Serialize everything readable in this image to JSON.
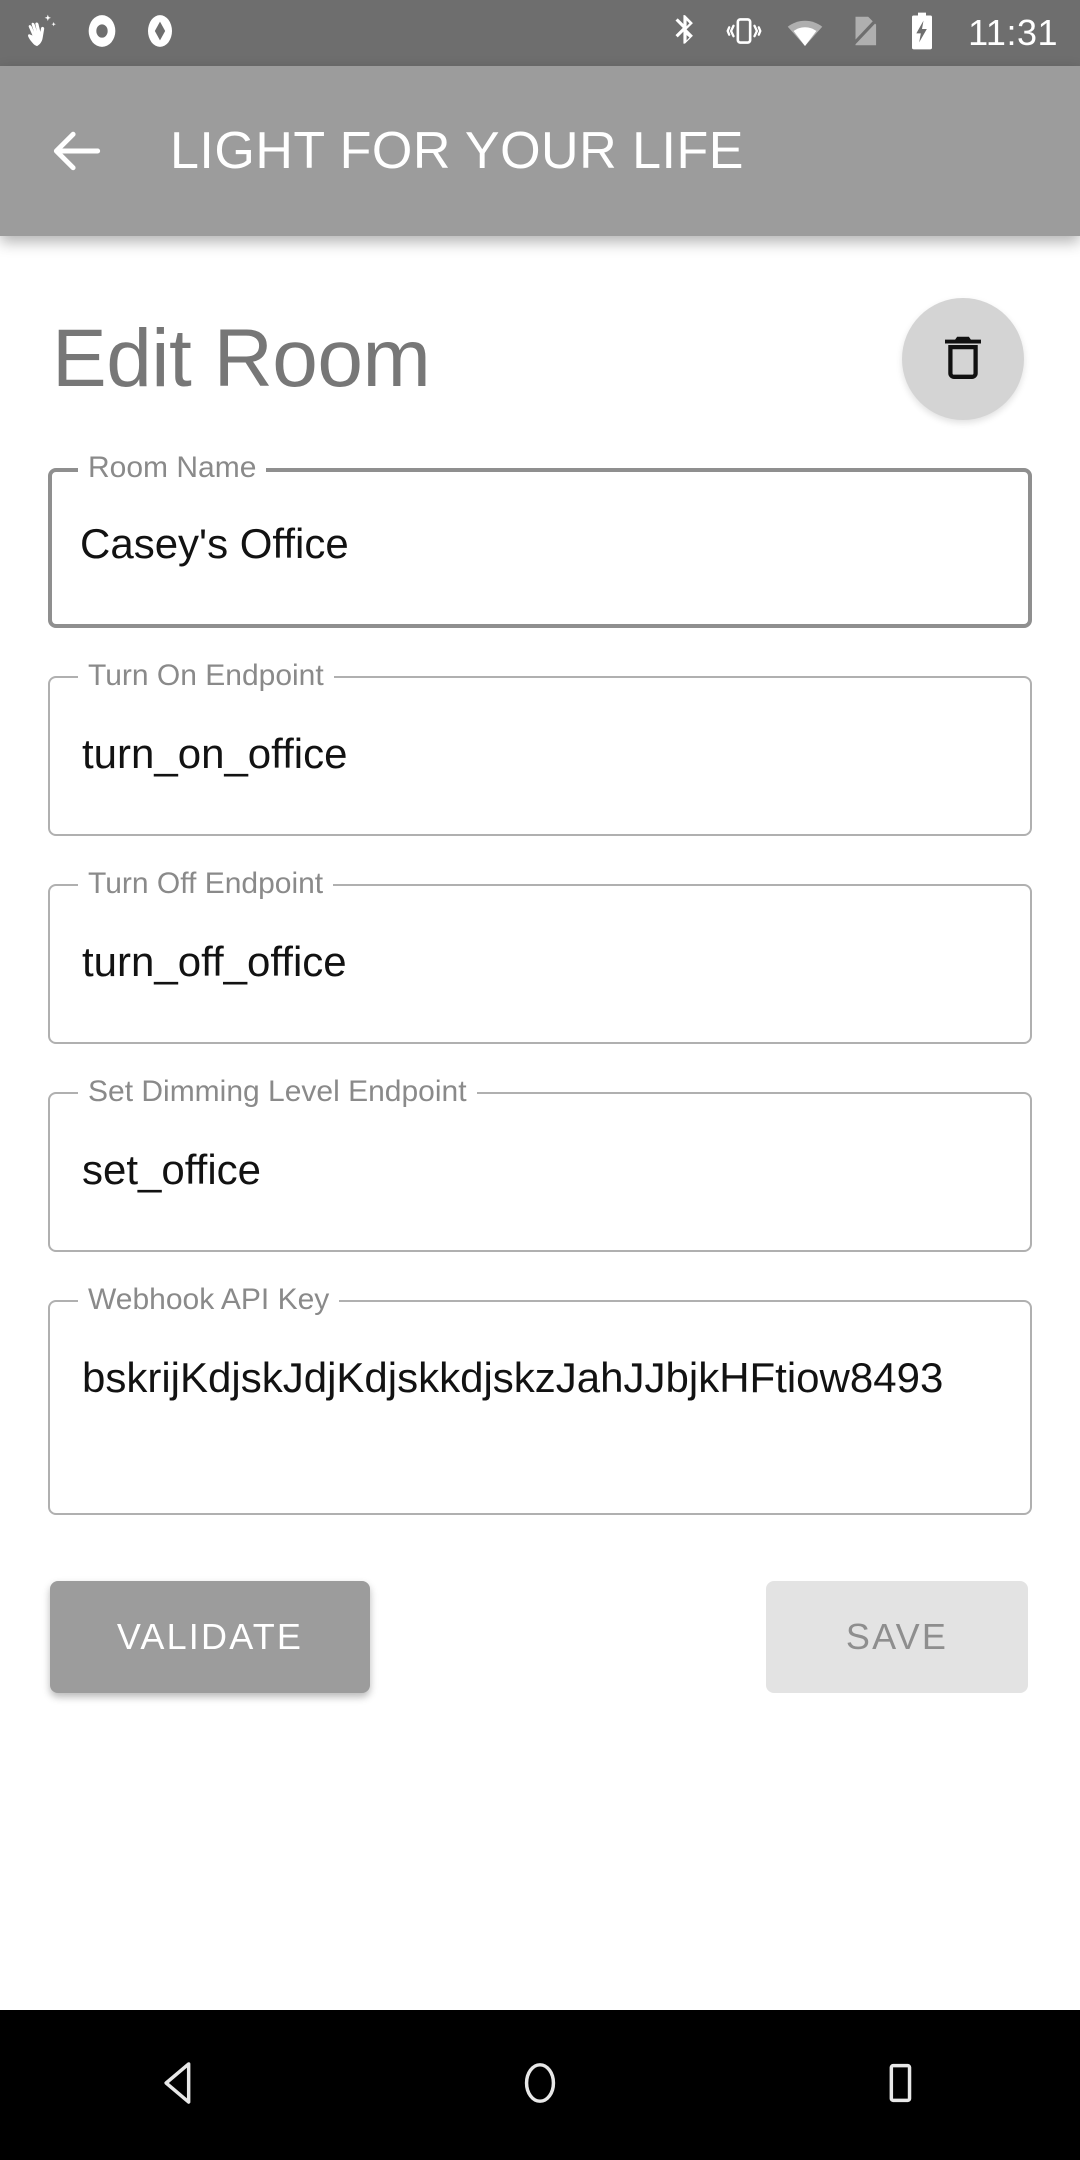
{
  "status_bar": {
    "background": "#6e6e6e",
    "time": "11:31",
    "left_icons": [
      "sparkle-hand-icon",
      "record-circle-icon",
      "diamond-icon"
    ],
    "right_icons": [
      "bluetooth-icon",
      "vibrate-icon",
      "wifi-icon",
      "sim-off-icon",
      "battery-charging-icon"
    ]
  },
  "app_bar": {
    "background": "#9c9c9c",
    "back_icon": "back-arrow-icon",
    "title": "LIGHT FOR YOUR LIFE"
  },
  "page": {
    "title": "Edit Room",
    "title_color": "#777777",
    "delete_button": {
      "icon": "trash-icon",
      "background": "#d4d4d4"
    }
  },
  "fields": [
    {
      "label": "Room Name",
      "value": "Casey's Office",
      "focused": true,
      "name": "room-name"
    },
    {
      "label": "Turn On Endpoint",
      "value": "turn_on_office",
      "focused": false,
      "name": "turn-on-endpoint"
    },
    {
      "label": "Turn Off Endpoint",
      "value": "turn_off_office",
      "focused": false,
      "name": "turn-off-endpoint"
    },
    {
      "label": "Set Dimming Level Endpoint",
      "value": "set_office",
      "focused": false,
      "name": "set-dimming-level-endpoint"
    },
    {
      "label": "Webhook API Key",
      "value": "bskrijKdjskJdjKdjskkdjskzJahJJbjkHFtiow8493",
      "focused": false,
      "name": "webhook-api-key"
    }
  ],
  "actions": {
    "validate_label": "VALIDATE",
    "validate_background": "#9c9c9c",
    "save_label": "SAVE",
    "save_background": "#e3e3e3",
    "save_disabled": true
  },
  "nav_bar": {
    "background": "#000000",
    "buttons": [
      "back-triangle-icon",
      "home-circle-icon",
      "recents-square-icon"
    ]
  }
}
